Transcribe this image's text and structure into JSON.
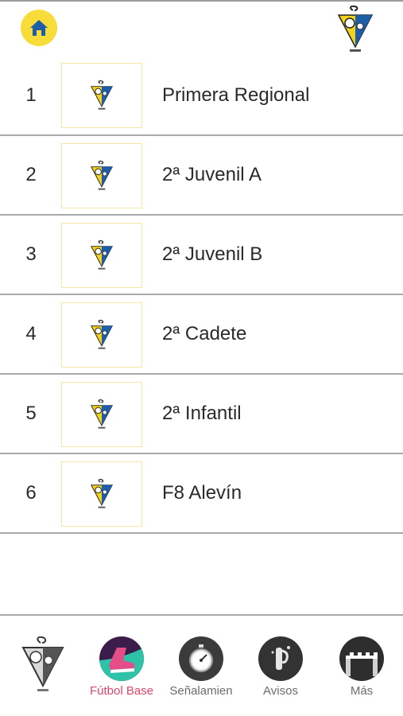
{
  "teams": [
    {
      "number": "1",
      "name": "Primera Regional"
    },
    {
      "number": "2",
      "name": "2ª Juvenil A"
    },
    {
      "number": "3",
      "name": "2ª Juvenil B"
    },
    {
      "number": "4",
      "name": "2ª Cadete"
    },
    {
      "number": "5",
      "name": "2ª Infantil"
    },
    {
      "number": "6",
      "name": "F8 Alevín"
    }
  ],
  "tabs": {
    "futbol_base": "Fútbol Base",
    "senalamientos": "Señalamien",
    "avisos": "Avisos",
    "mas": "Más"
  },
  "colors": {
    "home_button": "#f7dc3a",
    "active_tab": "#d9466a",
    "crest_yellow": "#f2d21b",
    "crest_blue": "#1e5ea8"
  },
  "icons": {
    "home": "home-icon",
    "club": "club-crest-icon",
    "futbol_base": "football-boot-icon",
    "senalamientos": "stopwatch-icon",
    "avisos": "notice-icon",
    "mas": "more-grid-icon"
  }
}
